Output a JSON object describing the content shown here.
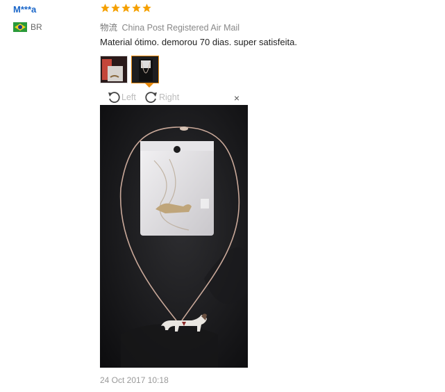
{
  "reviewer": {
    "name": "M***a",
    "country_code": "BR",
    "flag": "brazil-flag-icon"
  },
  "rating": {
    "stars": 5,
    "max": 5,
    "color": "#f5a000"
  },
  "shipping": {
    "label": "物流",
    "method": "China Post Registered Air Mail"
  },
  "review": {
    "text": "Material ótimo. demorou 70 dias. super satisfeita."
  },
  "thumbnails": {
    "count": 2,
    "selected_index": 1
  },
  "viewer": {
    "rotate_left": "Left",
    "rotate_right": "Right",
    "close": "×"
  },
  "date": "24 Oct 2017 10:18",
  "colors": {
    "name_link": "#1a66c9",
    "accent": "#e8890c",
    "muted": "#999999"
  }
}
